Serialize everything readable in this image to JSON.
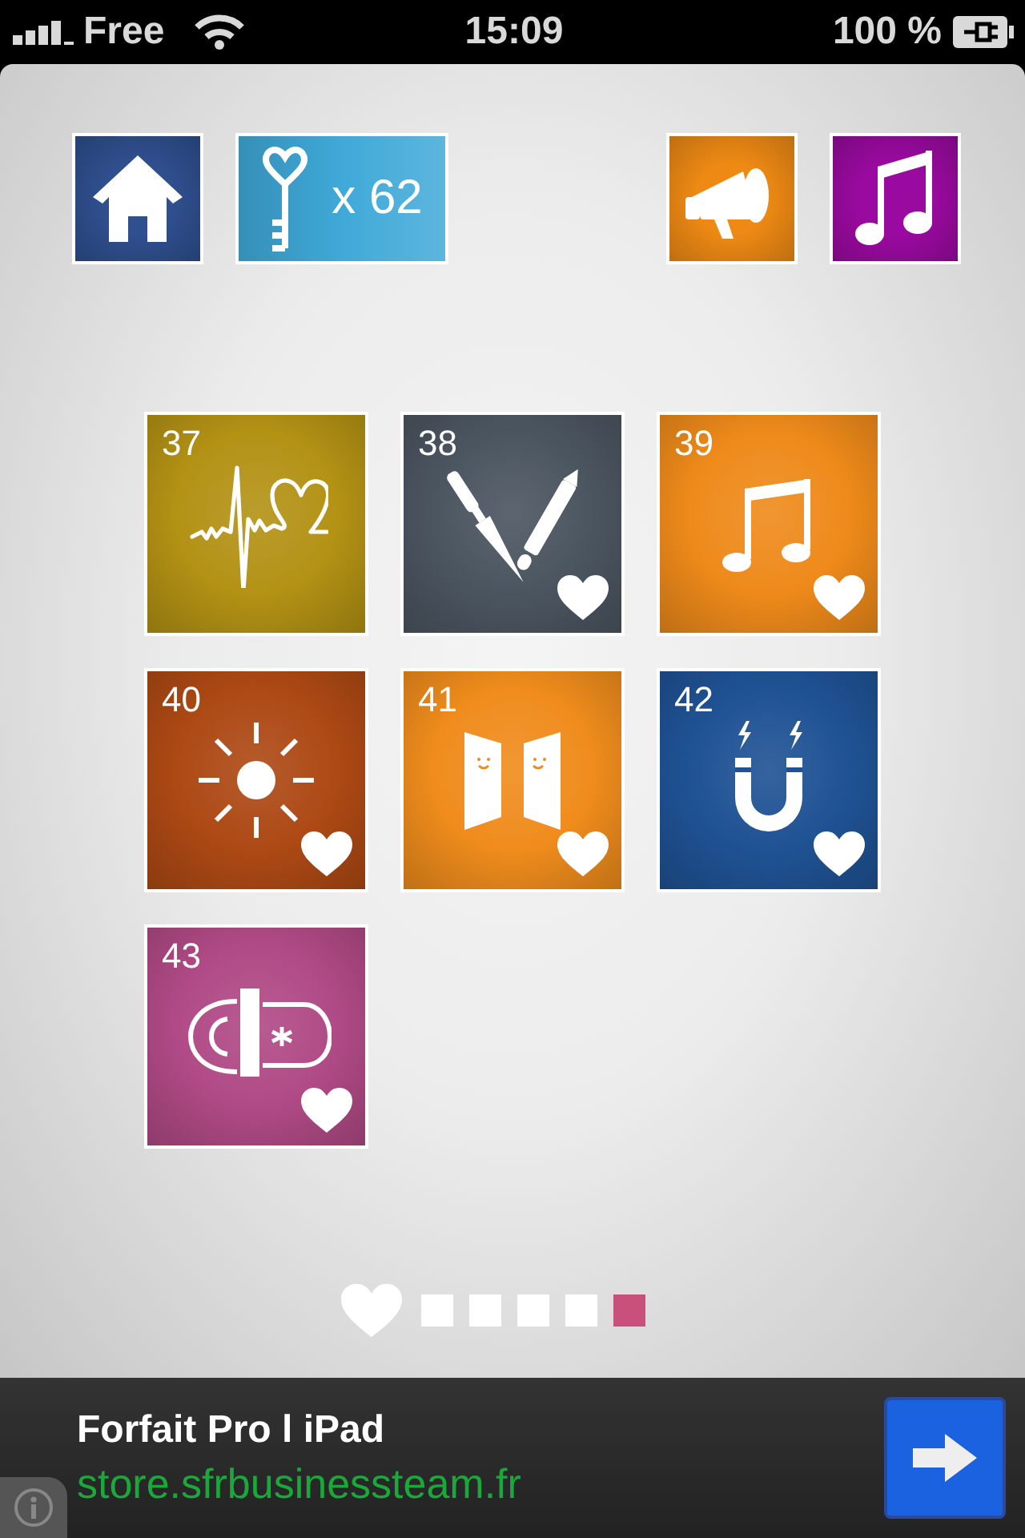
{
  "status_bar": {
    "carrier": "Free",
    "time": "15:09",
    "battery": "100 %"
  },
  "toolbar": {
    "buttons": [
      {
        "kind": "home",
        "color": "#2f4f8f"
      },
      {
        "kind": "keys",
        "color": "#3fa9d8",
        "count": "x 62"
      },
      {
        "kind": "megaphone",
        "color": "#ee8a14"
      },
      {
        "kind": "music",
        "color": "#9a0aa0"
      }
    ]
  },
  "tiles": [
    {
      "number": "37",
      "kind": "heartbeat",
      "color": "#b39214",
      "favorite": false
    },
    {
      "number": "38",
      "kind": "pen-brush",
      "color": "#4b5560",
      "favorite": true
    },
    {
      "number": "39",
      "kind": "music",
      "color": "#ee8a1a",
      "favorite": true
    },
    {
      "number": "40",
      "kind": "sun",
      "color": "#ad4914",
      "favorite": true
    },
    {
      "number": "41",
      "kind": "doors",
      "color": "#ef8c1c",
      "favorite": true
    },
    {
      "number": "42",
      "kind": "magnet",
      "color": "#1f5294",
      "favorite": true
    },
    {
      "number": "43",
      "kind": "pill",
      "color": "#b04a86",
      "favorite": true
    }
  ],
  "pager": [
    {
      "kind": "favorites",
      "selected": false
    },
    {
      "kind": "page",
      "selected": false
    },
    {
      "kind": "page",
      "selected": false
    },
    {
      "kind": "page",
      "selected": false
    },
    {
      "kind": "page",
      "selected": false
    },
    {
      "kind": "page",
      "selected": true
    }
  ],
  "ad": {
    "title": "Forfait Pro l iPad",
    "url": "store.sfrbusinessteam.fr"
  }
}
